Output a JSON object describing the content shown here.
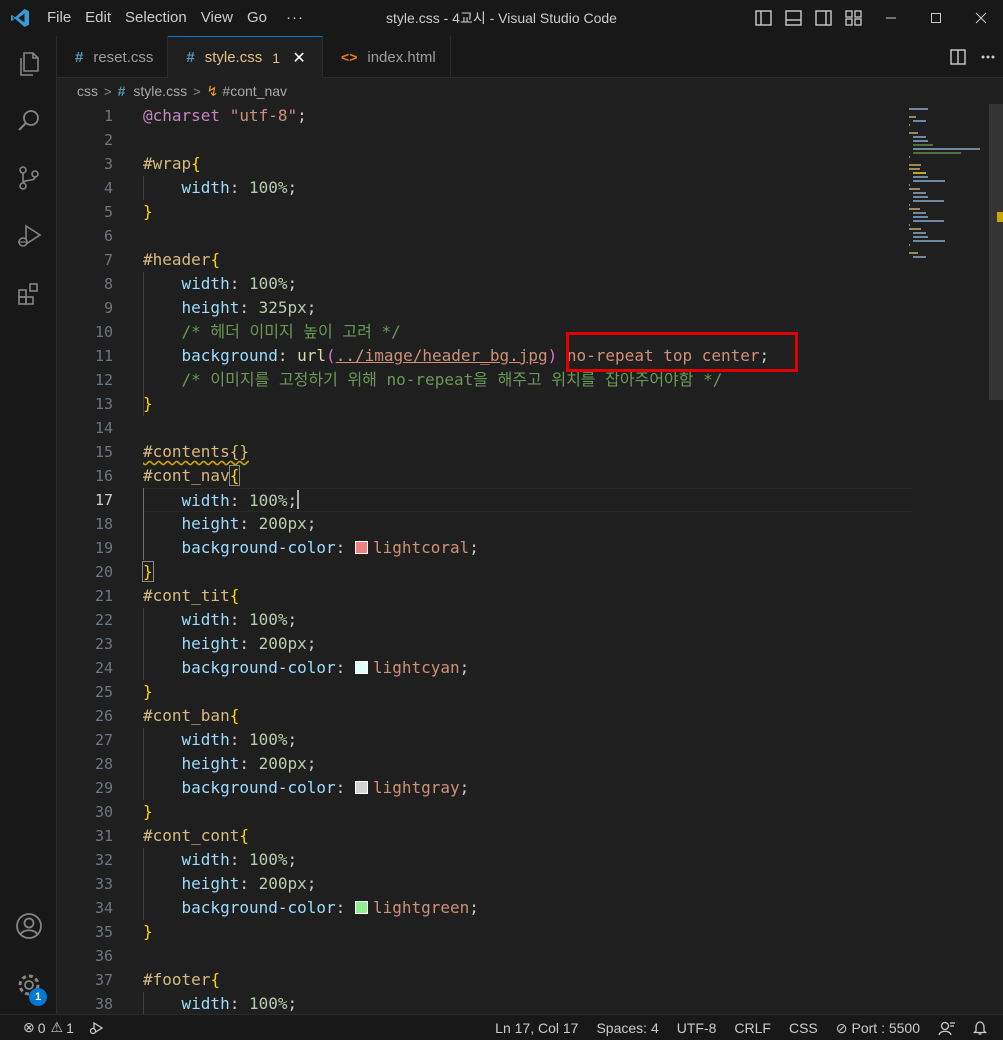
{
  "window": {
    "title": "style.css - 4교시 - Visual Studio Code",
    "menu": [
      "File",
      "Edit",
      "Selection",
      "View",
      "Go",
      "···"
    ]
  },
  "tabs": [
    {
      "label": "reset.css",
      "icon": "css-hash-icon",
      "active": false
    },
    {
      "label": "style.css",
      "icon": "css-hash-icon",
      "active": true,
      "problems": "1",
      "close": "✕"
    },
    {
      "label": "index.html",
      "icon": "html-icon",
      "active": false
    }
  ],
  "breadcrumb": {
    "folder": "css",
    "file": "style.css",
    "symbol": "#cont_nav"
  },
  "editor": {
    "active_line": 17,
    "line_numbers": [
      "1",
      "2",
      "3",
      "4",
      "5",
      "6",
      "7",
      "8",
      "9",
      "10",
      "11",
      "12",
      "13",
      "14",
      "15",
      "16",
      "17",
      "18",
      "19",
      "20",
      "21",
      "22",
      "23",
      "24",
      "25",
      "26",
      "27",
      "28",
      "29",
      "30",
      "31",
      "32",
      "33",
      "34",
      "35",
      "36",
      "37",
      "38"
    ],
    "lines": [
      "@charset \"utf-8\";",
      "",
      "#wrap{",
      "    width: 100%;",
      "}",
      "",
      "#header{",
      "    width: 100%;",
      "    height: 325px;",
      "    /* 헤더 이미지 높이 고려 */",
      "    background: url(../image/header_bg.jpg) no-repeat top center;",
      "    /* 이미지를 고정하기 위해 no-repeat을 해주고 위치를 잡아주어야함 */",
      "}",
      "",
      "#contents{}",
      "#cont_nav{",
      "    width: 100%;",
      "    height: 200px;",
      "    background-color: lightcoral;",
      "}",
      "#cont_tit{",
      "    width: 100%;",
      "    height: 200px;",
      "    background-color: lightcyan;",
      "}",
      "#cont_ban{",
      "    width: 100%;",
      "    height: 200px;",
      "    background-color: lightgray;",
      "}",
      "#cont_cont{",
      "    width: 100%;",
      "    height: 200px;",
      "    background-color: lightgreen;",
      "}",
      "",
      "#footer{",
      "    width: 100%;"
    ],
    "swatch_colors": {
      "lightcoral": "#f08080",
      "lightcyan": "#e0ffff",
      "lightgray": "#d3d3d3",
      "lightgreen": "#90ee90"
    }
  },
  "activity_bar": {
    "items": [
      "explorer-icon",
      "search-icon",
      "source-control-icon",
      "run-debug-icon",
      "extensions-icon"
    ],
    "bottom": [
      "accounts-icon",
      "manage-gear-icon"
    ],
    "manage_badge": "1"
  },
  "status_bar": {
    "errors": "0",
    "warnings": "1",
    "position": "Ln 17, Col 17",
    "spaces": "Spaces: 4",
    "encoding": "UTF-8",
    "eol": "CRLF",
    "language": "CSS",
    "port": "Port : 5500"
  },
  "colors": {
    "accent": "#0078d4",
    "highlight_box": "#e00000",
    "modified": "#e2c08d"
  }
}
